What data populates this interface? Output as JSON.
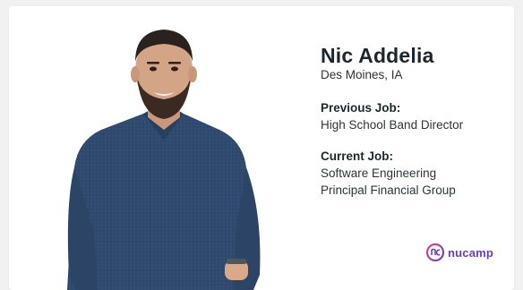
{
  "profile": {
    "name": "Nic Addelia",
    "location": "Des Moines, IA",
    "previous_job_label": "Previous Job:",
    "previous_job": "High School Band Director",
    "current_job_label": "Current Job:",
    "current_job_title": "Software Engineering",
    "current_job_company": "Principal Financial Group"
  },
  "brand": {
    "logo_text": "nucamp",
    "colors": {
      "primary": "#6a3fc4",
      "accent": "#e24a7a"
    }
  }
}
